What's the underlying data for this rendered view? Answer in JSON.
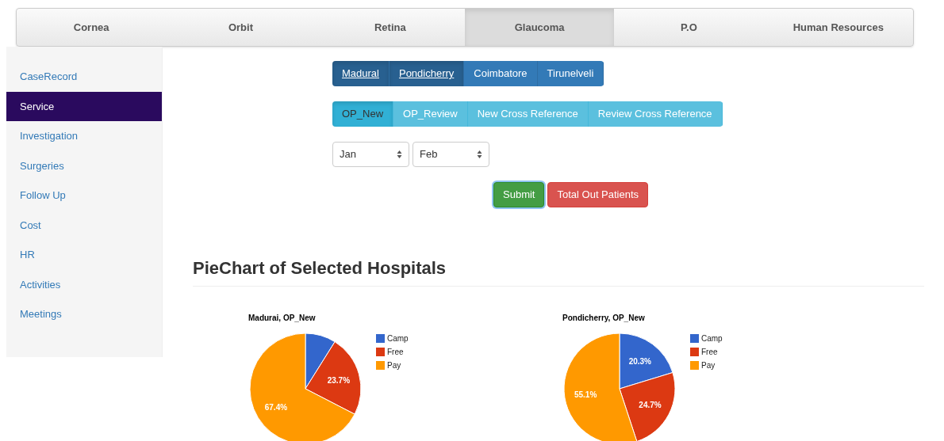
{
  "top_tabs": [
    {
      "label": "Cornea",
      "selected": false
    },
    {
      "label": "Orbit",
      "selected": false
    },
    {
      "label": "Retina",
      "selected": false
    },
    {
      "label": "Glaucoma",
      "selected": true
    },
    {
      "label": "P.O",
      "selected": false
    },
    {
      "label": "Human Resources",
      "selected": false
    }
  ],
  "sidebar": {
    "items": [
      {
        "label": "CaseRecord",
        "selected": false
      },
      {
        "label": "Service",
        "selected": true
      },
      {
        "label": "Investigation",
        "selected": false
      },
      {
        "label": "Surgeries",
        "selected": false
      },
      {
        "label": "Follow Up",
        "selected": false
      },
      {
        "label": "Cost",
        "selected": false
      },
      {
        "label": "HR",
        "selected": false
      },
      {
        "label": "Activities",
        "selected": false
      },
      {
        "label": "Meetings",
        "selected": false
      }
    ]
  },
  "hospitals": [
    {
      "label": "Madural",
      "selected": true
    },
    {
      "label": "Pondicherry",
      "selected": true
    },
    {
      "label": "Coimbatore",
      "selected": false
    },
    {
      "label": "Tirunelveli",
      "selected": false
    }
  ],
  "categories": [
    {
      "label": "OP_New",
      "selected": true
    },
    {
      "label": "OP_Review",
      "selected": false
    },
    {
      "label": "New Cross Reference",
      "selected": false
    },
    {
      "label": "Review Cross Reference",
      "selected": false
    }
  ],
  "from_month": {
    "value": "Jan"
  },
  "to_month": {
    "value": "Feb"
  },
  "buttons": [
    {
      "label": "Submit",
      "kind": "success"
    },
    {
      "label": "Total Out Patients",
      "kind": "danger"
    }
  ],
  "heading": "PieChart of Selected Hospitals",
  "charts": [
    {
      "chart_data": {
        "type": "pie",
        "title": "Madurai, OP_New",
        "categories": [
          "Camp",
          "Free",
          "Pay"
        ],
        "colors": [
          "#3366cc",
          "#dc3912",
          "#ff9900"
        ],
        "series": [
          {
            "values": [
              8.9,
              23.7,
              67.4
            ]
          }
        ],
        "value_labels": [
          null,
          "23.7%",
          "67.4%"
        ],
        "legend": "right"
      }
    },
    {
      "chart_data": {
        "type": "pie",
        "title": "Pondicherry, OP_New",
        "categories": [
          "Camp",
          "Free",
          "Pay"
        ],
        "colors": [
          "#3366cc",
          "#dc3912",
          "#ff9900"
        ],
        "series": [
          {
            "values": [
              20.3,
              24.7,
              55.1
            ]
          }
        ],
        "value_labels": [
          "20.3%",
          "24.7%",
          "55.1%"
        ],
        "legend": "right"
      }
    }
  ]
}
